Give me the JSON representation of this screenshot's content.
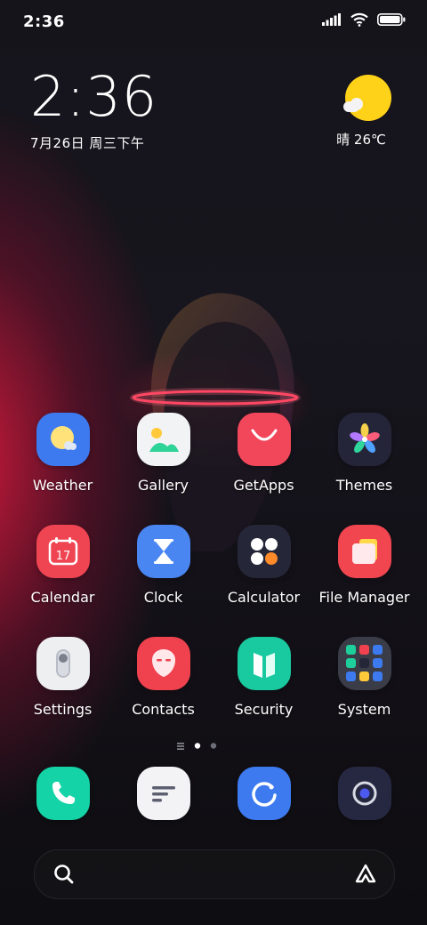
{
  "status_bar": {
    "time": "2:36",
    "icons": [
      "signal-icon",
      "wifi-icon",
      "battery-icon"
    ]
  },
  "clock_widget": {
    "time": "2:36",
    "date": "7月26日 周三下午"
  },
  "weather_widget": {
    "icon": "sun-with-cloud-icon",
    "text": "晴 26℃"
  },
  "apps": [
    {
      "label": "Weather",
      "icon": "weather-icon",
      "color": "#3d7af0"
    },
    {
      "label": "Gallery",
      "icon": "gallery-icon",
      "color": "#f2f3f5"
    },
    {
      "label": "GetApps",
      "icon": "getapps-icon",
      "color": "#f2475a"
    },
    {
      "label": "Themes",
      "icon": "themes-icon",
      "color": "#25253a"
    },
    {
      "label": "Calendar",
      "icon": "calendar-icon",
      "color": "#ef4552",
      "day": "17"
    },
    {
      "label": "Clock",
      "icon": "clock-icon",
      "color": "#4a86f2"
    },
    {
      "label": "Calculator",
      "icon": "calculator-icon",
      "color": "#252638"
    },
    {
      "label": "File Manager",
      "icon": "file-manager-icon",
      "color": "#f1454f"
    },
    {
      "label": "Settings",
      "icon": "settings-icon",
      "color": "#eeeff1"
    },
    {
      "label": "Contacts",
      "icon": "contacts-icon",
      "color": "#f0424e"
    },
    {
      "label": "Security",
      "icon": "security-icon",
      "color": "#19c9a0"
    },
    {
      "label": "System",
      "icon": "system-folder-icon",
      "color": "#3a3c48"
    }
  ],
  "page_indicator": {
    "pages": 2,
    "current": 1
  },
  "dock": [
    {
      "icon": "phone-icon",
      "color": "#14d3a6"
    },
    {
      "icon": "messages-icon",
      "color": "#f3f3f5"
    },
    {
      "icon": "browser-icon",
      "color": "#3d7af0"
    },
    {
      "icon": "camera-icon",
      "color": "#262842"
    }
  ],
  "search_bar": {
    "left_icon": "search-icon",
    "right_icon": "assistant-icon"
  }
}
